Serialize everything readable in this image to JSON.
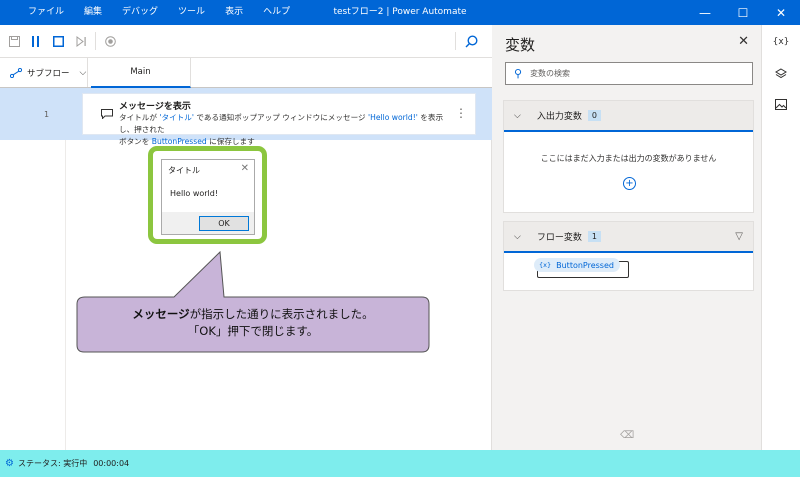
{
  "window": {
    "title": "testフロー2 | Power Automate",
    "menu": [
      "ファイル",
      "編集",
      "デバッグ",
      "ツール",
      "表示",
      "ヘルプ"
    ]
  },
  "tabs": {
    "subflow_label": "サブフロー",
    "main_label": "Main"
  },
  "action": {
    "line_number": "1",
    "title": "メッセージを表示",
    "desc_1": "タイトルが",
    "desc_title_value": "'タイトル'",
    "desc_2": "である通知ポップアップ ウィンドウにメッセージ",
    "desc_message_value": "'Hello world!'",
    "desc_3": "を表示し、押された",
    "desc_4": "ボタンを",
    "desc_var": "ButtonPressed",
    "desc_5": "に保存します"
  },
  "message_box": {
    "title": "タイトル",
    "text": "Hello world!",
    "ok_label": "OK"
  },
  "callout": {
    "bold": "メッセージ",
    "line1_rest": "が指示した通りに表示されました。",
    "line2": "「OK」押下で閉じます。"
  },
  "variables_panel": {
    "title": "変数",
    "search_placeholder": "変数の検索",
    "io_section": {
      "label": "入出力変数",
      "count": "0",
      "empty_message": "ここにはまだ入力または出力の変数がありません"
    },
    "flow_section": {
      "label": "フロー変数",
      "count": "1",
      "variables": [
        "ButtonPressed"
      ],
      "var_prefix": "{x}"
    }
  },
  "rail": {
    "variables_icon_label": "{x}"
  },
  "status": {
    "text": "ステータス: 実行中",
    "elapsed": "00:00:04"
  },
  "colors": {
    "accent": "#0066d6",
    "status_bar": "#7eeded",
    "highlight_row": "#cfe2f9",
    "msgbox_border": "#8cc63f",
    "callout_fill": "#c8b4d8"
  }
}
